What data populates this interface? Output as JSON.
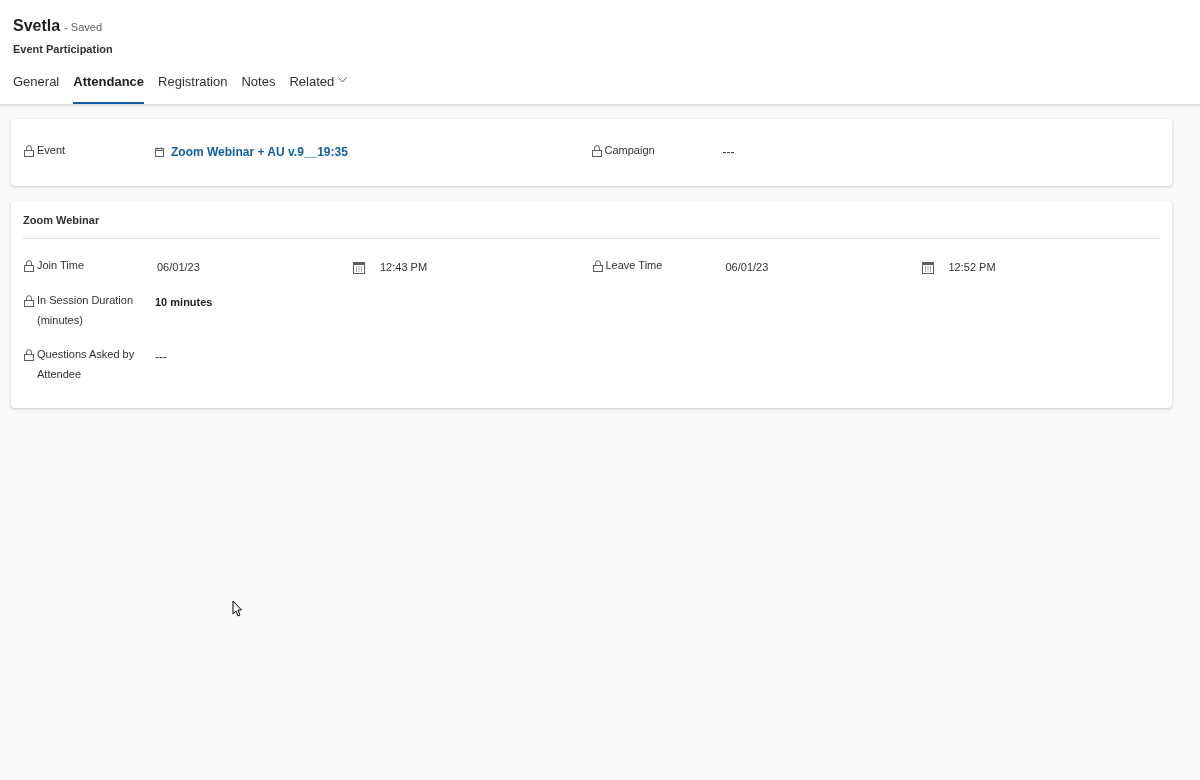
{
  "header": {
    "title": "Svetla",
    "save_status": "- Saved",
    "entity": "Event Participation"
  },
  "tabs": [
    {
      "label": "General",
      "selected": false
    },
    {
      "label": "Attendance",
      "selected": true
    },
    {
      "label": "Registration",
      "selected": false
    },
    {
      "label": "Notes",
      "selected": false
    },
    {
      "label": "Related",
      "selected": false,
      "kind": "menu"
    }
  ],
  "top_card": {
    "fields": [
      {
        "label": "Event",
        "kind": "lookup",
        "locked": true,
        "value": "Zoom Webinar + AU v.9__19:35"
      },
      {
        "label": "Campaign",
        "kind": "text",
        "locked": true,
        "value": "---"
      }
    ]
  },
  "section": {
    "title": "Zoom Webinar",
    "rows": [
      [
        {
          "label": "Join Time",
          "kind": "datetime",
          "locked": true,
          "date": "06/01/23",
          "time": "12:43 PM"
        },
        {
          "label": "Leave Time",
          "kind": "datetime",
          "locked": true,
          "date": "06/01/23",
          "time": "12:52 PM"
        }
      ],
      [
        {
          "label": "In Session Duration (minutes)",
          "kind": "number",
          "locked": true,
          "value": "10 minutes"
        }
      ],
      [
        {
          "label": "Questions Asked by Attendee",
          "kind": "text",
          "locked": true,
          "value": "---"
        }
      ]
    ]
  }
}
